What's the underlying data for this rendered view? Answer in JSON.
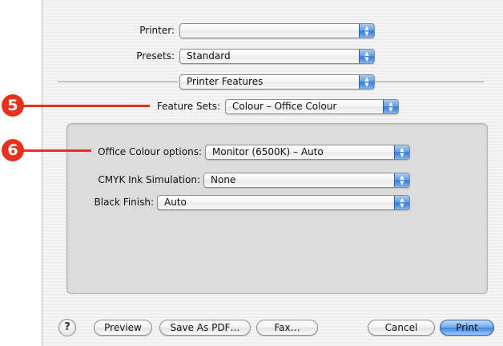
{
  "print_dialog": {
    "printer": {
      "label": "Printer:",
      "value": ""
    },
    "presets": {
      "label": "Presets:",
      "value": "Standard"
    },
    "panel": {
      "value": "Printer Features"
    },
    "feature_sets": {
      "label": "Feature Sets:",
      "value": "Colour – Office Colour"
    },
    "options": [
      {
        "label": "Office Colour options:",
        "value": "Monitor (6500K) – Auto"
      },
      {
        "label": "CMYK Ink Simulation:",
        "value": "None"
      },
      {
        "label": "Black Finish:",
        "value": "Auto"
      }
    ],
    "buttons": {
      "help": "?",
      "preview": "Preview",
      "save_pdf": "Save As PDF…",
      "fax": "Fax…",
      "cancel": "Cancel",
      "print": "Print"
    }
  },
  "callouts": [
    {
      "number": "5"
    },
    {
      "number": "6"
    }
  ],
  "colors": {
    "callout": "#e8311b",
    "accent_blue": "#3d86df"
  }
}
